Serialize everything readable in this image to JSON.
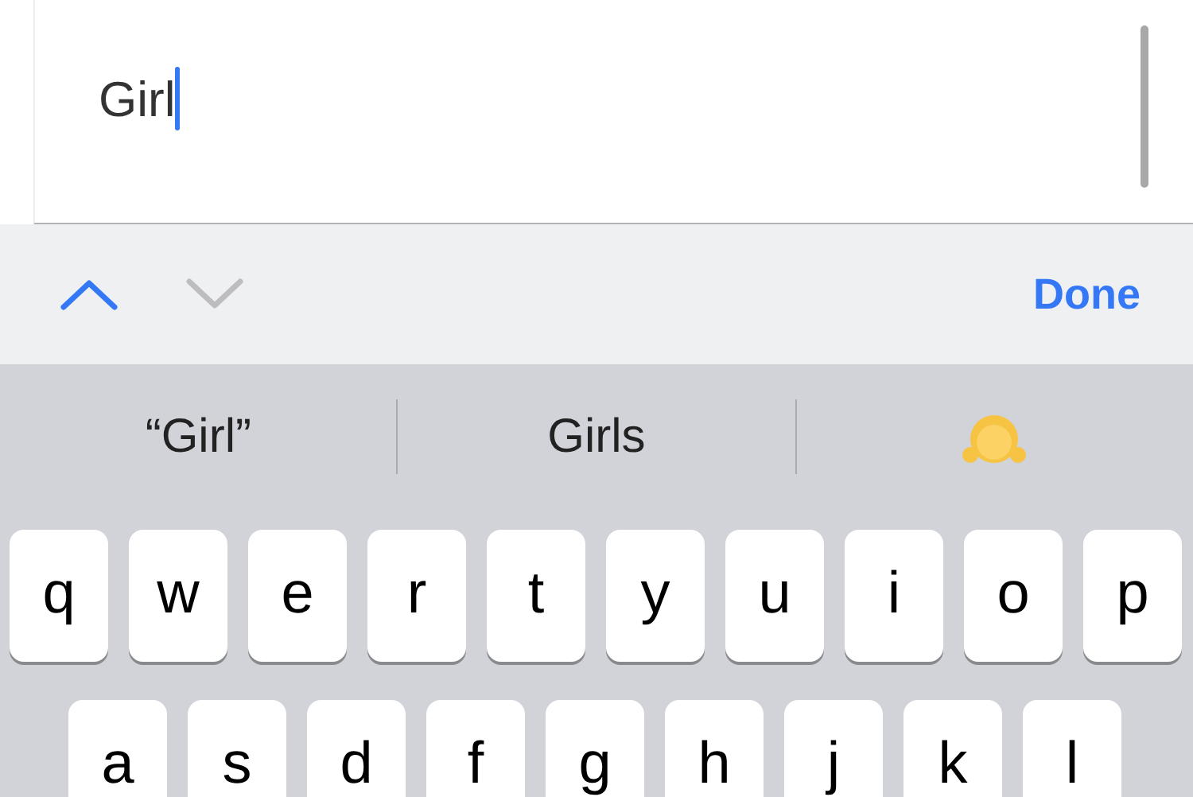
{
  "editor": {
    "text": "Girl"
  },
  "toolbar": {
    "previous": {
      "disabled": false
    },
    "next": {
      "disabled": true
    },
    "done": "Done"
  },
  "suggestions": [
    {
      "kind": "text",
      "label": "“Girl”"
    },
    {
      "kind": "text",
      "label": "Girls"
    },
    {
      "kind": "emoji"
    }
  ],
  "keyboard": {
    "rows": [
      [
        "q",
        "w",
        "e",
        "r",
        "t",
        "y",
        "u",
        "i",
        "o",
        "p"
      ],
      [
        "a",
        "s",
        "d",
        "f",
        "g",
        "h",
        "j",
        "k",
        "l"
      ]
    ]
  }
}
